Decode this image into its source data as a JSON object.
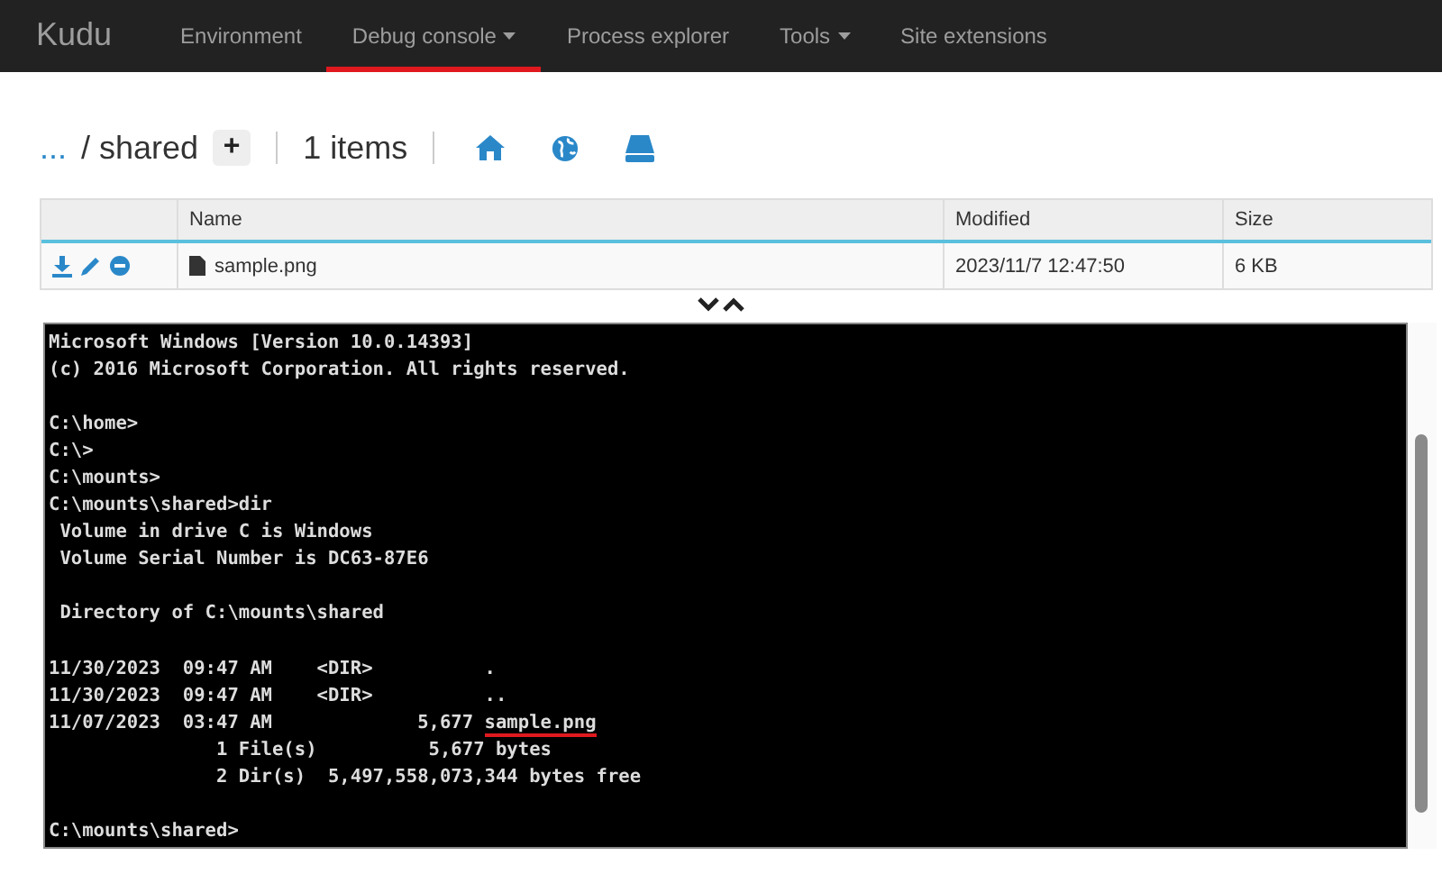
{
  "navbar": {
    "brand": "Kudu",
    "items": [
      {
        "label": "Environment",
        "selected": false,
        "dropdown": false
      },
      {
        "label": "Debug console",
        "selected": true,
        "dropdown": true
      },
      {
        "label": "Process explorer",
        "selected": false,
        "dropdown": false
      },
      {
        "label": "Tools",
        "selected": false,
        "dropdown": true
      },
      {
        "label": "Site extensions",
        "selected": false,
        "dropdown": false
      }
    ]
  },
  "breadcrumb": {
    "parent": "...",
    "current": "/ shared",
    "add_button": "+",
    "count": "1 items"
  },
  "table": {
    "columns": [
      "Name",
      "Modified",
      "Size"
    ],
    "rows": [
      {
        "name": "sample.png",
        "modified": "2023/11/7 12:47:50",
        "size": "6 KB"
      }
    ]
  },
  "console": {
    "lines": [
      {
        "kind": "text",
        "text": "Microsoft Windows [Version 10.0.14393]"
      },
      {
        "kind": "text",
        "text": "(c) 2016 Microsoft Corporation. All rights reserved."
      },
      {
        "kind": "blank"
      },
      {
        "kind": "text",
        "text": "C:\\home>"
      },
      {
        "kind": "text",
        "text": "C:\\>"
      },
      {
        "kind": "text",
        "text": "C:\\mounts>"
      },
      {
        "kind": "text",
        "text": "C:\\mounts\\shared>dir"
      },
      {
        "kind": "text",
        "text": " Volume in drive C is Windows"
      },
      {
        "kind": "text",
        "text": " Volume Serial Number is DC63-87E6"
      },
      {
        "kind": "blank"
      },
      {
        "kind": "text",
        "text": " Directory of C:\\mounts\\shared"
      },
      {
        "kind": "blank"
      },
      {
        "kind": "text",
        "text": "11/30/2023  09:47 AM    <DIR>          ."
      },
      {
        "kind": "text",
        "text": "11/30/2023  09:47 AM    <DIR>          .."
      },
      {
        "kind": "text",
        "text": "11/07/2023  03:47 AM             5,677 ",
        "marked": "sample.png"
      },
      {
        "kind": "text",
        "text": "               1 File(s)          5,677 bytes"
      },
      {
        "kind": "text",
        "text": "               2 Dir(s)  5,497,558,073,344 bytes free"
      },
      {
        "kind": "blank"
      },
      {
        "kind": "text",
        "text": "C:\\mounts\\shared>"
      }
    ]
  }
}
